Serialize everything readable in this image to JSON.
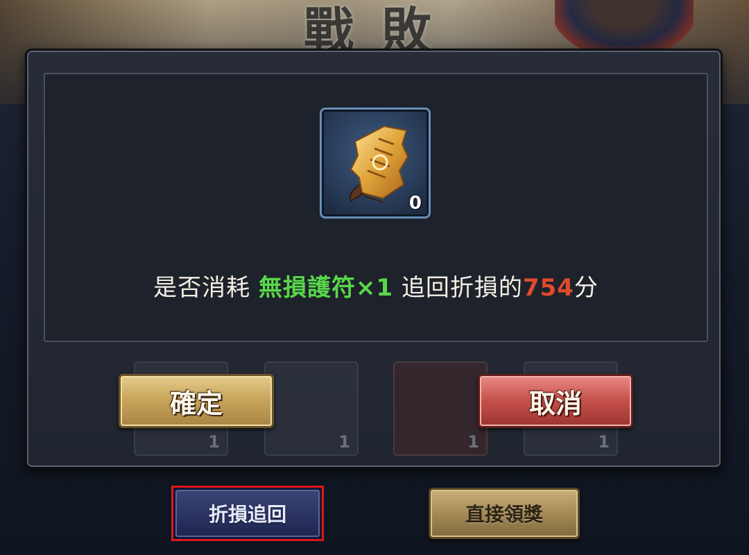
{
  "background": {
    "title": "戰敗"
  },
  "dialog": {
    "item": {
      "icon": "talisman-scroll-icon",
      "count": "0"
    },
    "message": {
      "prefix": "是否消耗 ",
      "item_name": "無損護符",
      "quantity": "×1",
      "middle": " 追回折損的",
      "points": "754",
      "suffix": "分"
    },
    "confirm_label": "確定",
    "cancel_label": "取消",
    "ghost_slots": [
      "1",
      "1",
      "1",
      "1"
    ]
  },
  "footer": {
    "recover_label": "折損追回",
    "claim_label": "直接領獎"
  },
  "colors": {
    "highlight_item": "#58d84a",
    "highlight_points": "#e04a2c",
    "focus_outline": "#e01818"
  }
}
